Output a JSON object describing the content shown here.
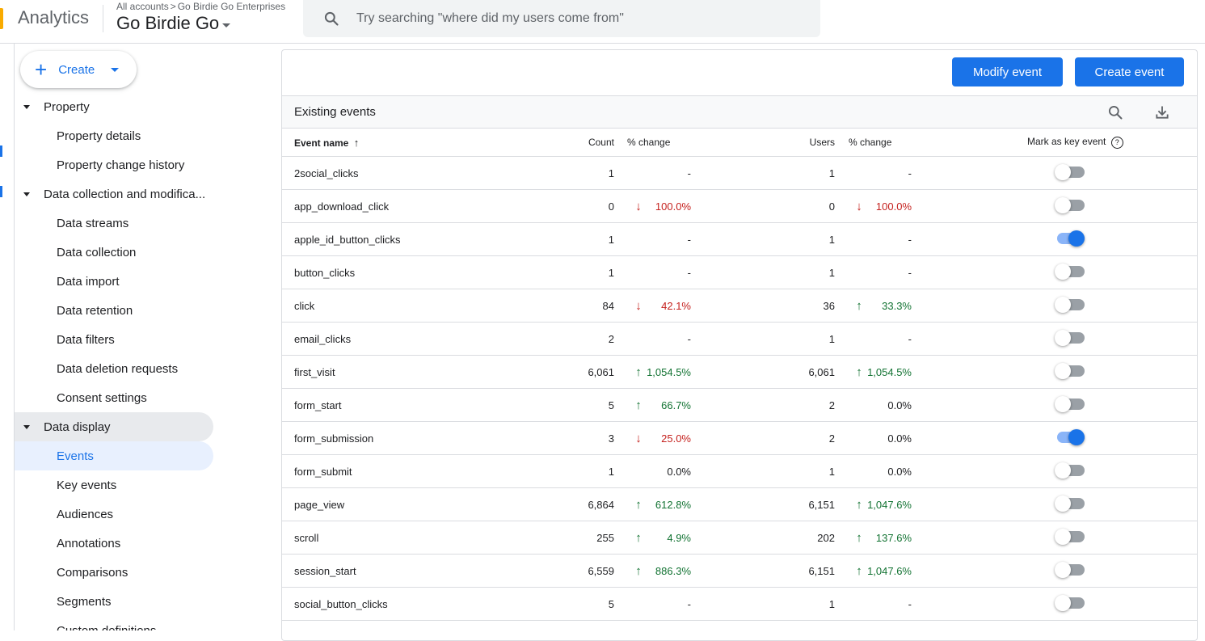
{
  "header": {
    "app_name": "Analytics",
    "breadcrumb_all": "All accounts",
    "breadcrumb_sep": ">",
    "breadcrumb_account": "Go Birdie Go Enterprises",
    "property_name": "Go Birdie Go",
    "search_placeholder": "Try searching \"where did my users come from\""
  },
  "sidebar": {
    "create_label": "Create",
    "items": [
      {
        "label": "Property",
        "type": "section"
      },
      {
        "label": "Property details",
        "type": "child"
      },
      {
        "label": "Property change history",
        "type": "child"
      },
      {
        "label": "Data collection and modifica...",
        "type": "section"
      },
      {
        "label": "Data streams",
        "type": "child"
      },
      {
        "label": "Data collection",
        "type": "child"
      },
      {
        "label": "Data import",
        "type": "child"
      },
      {
        "label": "Data retention",
        "type": "child"
      },
      {
        "label": "Data filters",
        "type": "child"
      },
      {
        "label": "Data deletion requests",
        "type": "child"
      },
      {
        "label": "Consent settings",
        "type": "child"
      },
      {
        "label": "Data display",
        "type": "section"
      },
      {
        "label": "Events",
        "type": "child"
      },
      {
        "label": "Key events",
        "type": "child"
      },
      {
        "label": "Audiences",
        "type": "child"
      },
      {
        "label": "Annotations",
        "type": "child"
      },
      {
        "label": "Comparisons",
        "type": "child"
      },
      {
        "label": "Segments",
        "type": "child"
      },
      {
        "label": "Custom definitions",
        "type": "child"
      }
    ]
  },
  "main": {
    "modify_event_label": "Modify event",
    "create_event_label": "Create event",
    "section_title": "Existing events",
    "columns": {
      "event_name": "Event name",
      "count": "Count",
      "count_change": "% change",
      "users": "Users",
      "users_change": "% change",
      "key_event": "Mark as key event",
      "help": "?"
    },
    "rows": [
      {
        "name": "2social_clicks",
        "count": "1",
        "count_change": "-",
        "count_dir": "",
        "users": "1",
        "users_change": "-",
        "users_dir": "",
        "key": false
      },
      {
        "name": "app_download_click",
        "count": "0",
        "count_change": "100.0%",
        "count_dir": "down",
        "users": "0",
        "users_change": "100.0%",
        "users_dir": "down",
        "key": false
      },
      {
        "name": "apple_id_button_clicks",
        "count": "1",
        "count_change": "-",
        "count_dir": "",
        "users": "1",
        "users_change": "-",
        "users_dir": "",
        "key": true
      },
      {
        "name": "button_clicks",
        "count": "1",
        "count_change": "-",
        "count_dir": "",
        "users": "1",
        "users_change": "-",
        "users_dir": "",
        "key": false
      },
      {
        "name": "click",
        "count": "84",
        "count_change": "42.1%",
        "count_dir": "down",
        "users": "36",
        "users_change": "33.3%",
        "users_dir": "up",
        "key": false
      },
      {
        "name": "email_clicks",
        "count": "2",
        "count_change": "-",
        "count_dir": "",
        "users": "1",
        "users_change": "-",
        "users_dir": "",
        "key": false
      },
      {
        "name": "first_visit",
        "count": "6,061",
        "count_change": "1,054.5%",
        "count_dir": "up",
        "users": "6,061",
        "users_change": "1,054.5%",
        "users_dir": "up",
        "key": false
      },
      {
        "name": "form_start",
        "count": "5",
        "count_change": "66.7%",
        "count_dir": "up",
        "users": "2",
        "users_change": "0.0%",
        "users_dir": "",
        "key": false
      },
      {
        "name": "form_submission",
        "count": "3",
        "count_change": "25.0%",
        "count_dir": "down",
        "users": "2",
        "users_change": "0.0%",
        "users_dir": "",
        "key": true
      },
      {
        "name": "form_submit",
        "count": "1",
        "count_change": "0.0%",
        "count_dir": "",
        "users": "1",
        "users_change": "0.0%",
        "users_dir": "",
        "key": false
      },
      {
        "name": "page_view",
        "count": "6,864",
        "count_change": "612.8%",
        "count_dir": "up",
        "users": "6,151",
        "users_change": "1,047.6%",
        "users_dir": "up",
        "key": false
      },
      {
        "name": "scroll",
        "count": "255",
        "count_change": "4.9%",
        "count_dir": "up",
        "users": "202",
        "users_change": "137.6%",
        "users_dir": "up",
        "key": false
      },
      {
        "name": "session_start",
        "count": "6,559",
        "count_change": "886.3%",
        "count_dir": "up",
        "users": "6,151",
        "users_change": "1,047.6%",
        "users_dir": "up",
        "key": false
      },
      {
        "name": "social_button_clicks",
        "count": "5",
        "count_change": "-",
        "count_dir": "",
        "users": "1",
        "users_change": "-",
        "users_dir": "",
        "key": false
      }
    ]
  },
  "colors": {
    "accent": "#1a73e8",
    "up": "#137333",
    "down": "#c5221f",
    "logo": "#f9ab00"
  }
}
